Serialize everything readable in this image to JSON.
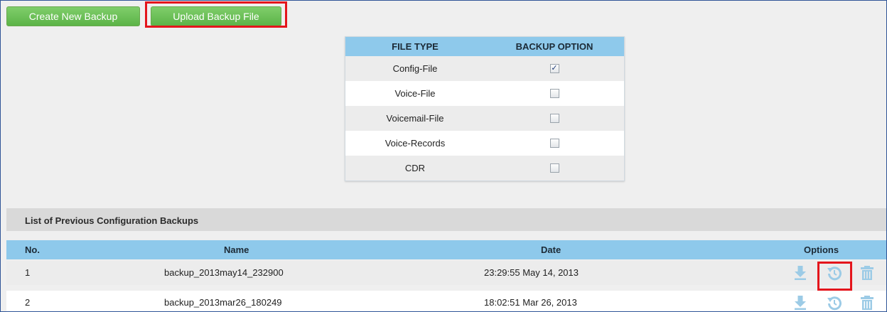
{
  "toolbar": {
    "create_label": "Create New Backup",
    "upload_label": "Upload Backup File"
  },
  "file_types": {
    "headers": [
      "FILE TYPE",
      "BACKUP OPTION"
    ],
    "rows": [
      {
        "label": "Config-File",
        "checked": true
      },
      {
        "label": "Voice-File",
        "checked": false
      },
      {
        "label": "Voicemail-File",
        "checked": false
      },
      {
        "label": "Voice-Records",
        "checked": false
      },
      {
        "label": "CDR",
        "checked": false
      }
    ]
  },
  "backups": {
    "title": "List of Previous Configuration Backups",
    "headers": {
      "no": "No.",
      "name": "Name",
      "date": "Date",
      "options": "Options"
    },
    "rows": [
      {
        "no": "1",
        "name": "backup_2013may14_232900",
        "date": "23:29:55 May 14, 2013"
      },
      {
        "no": "2",
        "name": "backup_2013mar26_180249",
        "date": "18:02:51 Mar 26, 2013"
      }
    ]
  },
  "icons": {
    "download": "download-icon",
    "restore": "restore-icon",
    "delete": "trash-icon"
  },
  "colors": {
    "button_green": "#5cb447",
    "header_blue": "#8ec9eb",
    "highlight_red": "#e4151c",
    "icon_blue": "#9ccbe6"
  }
}
